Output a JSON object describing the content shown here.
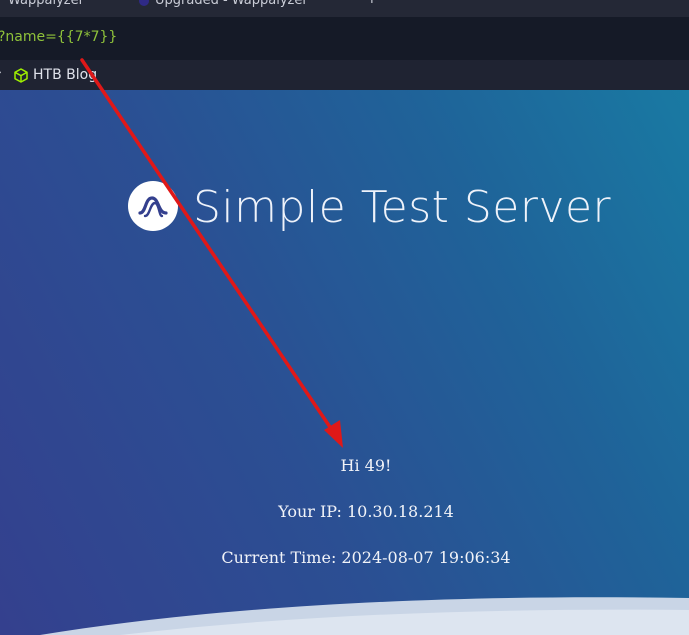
{
  "browser": {
    "tabs": [
      {
        "label": "Wappalyzer"
      },
      {
        "label": "Upgraded - Wappalyzer"
      }
    ],
    "new_tab_label": "+",
    "url": "?name={{7*7}}",
    "bookmarks": [
      {
        "label": "HTB Blog",
        "icon": "hackthebox-cube-icon"
      }
    ],
    "colors": {
      "url_text": "#8fc23a",
      "bookmark_icon": "#9fef00"
    }
  },
  "page": {
    "title": "Simple Test Server",
    "greeting": "Hi 49!",
    "ip_line": "Your IP: 10.30.18.214",
    "time_line": "Current Time: 2024-08-07 19:06:34",
    "logo_icon": "wave-logo-icon"
  },
  "annotation": {
    "arrow_color": "#e01818",
    "icon": "red-arrow-annotation"
  }
}
